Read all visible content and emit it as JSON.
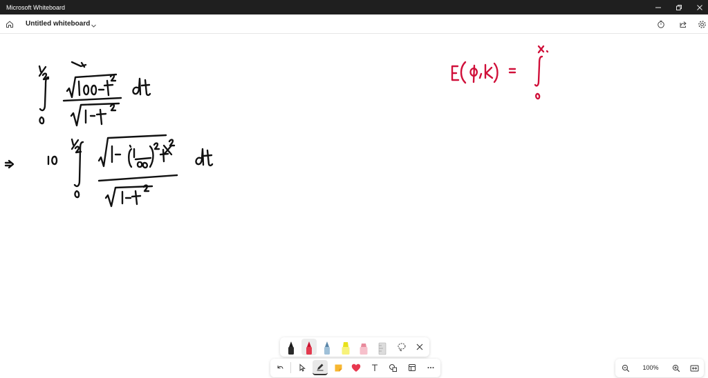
{
  "window": {
    "title": "Microsoft Whiteboard",
    "controls": [
      "minimize",
      "restore",
      "close"
    ]
  },
  "header": {
    "board_name": "Untitled whiteboard",
    "icons": [
      "home-icon",
      "chevron-down-icon",
      "timer-icon",
      "share-icon",
      "settings-icon"
    ]
  },
  "canvas": {
    "ink_black": "#111111",
    "ink_red": "#d0103a"
  },
  "pen_tray": {
    "pens": [
      {
        "name": "black-pen",
        "color": "#1a1a1a"
      },
      {
        "name": "red-pen",
        "color": "#c8102e",
        "active": true
      },
      {
        "name": "blue-pen",
        "color": "#7fa7c4"
      },
      {
        "name": "yellow-highlighter",
        "color": "#f4ee3a"
      },
      {
        "name": "pink-highlighter",
        "color": "#f2a7b4"
      },
      {
        "name": "ruler",
        "color": "#cccccc"
      }
    ]
  },
  "toolbar": {
    "tools": [
      "undo-icon",
      "select-icon",
      "pen-icon",
      "sticky-note-icon",
      "reactions-icon",
      "text-icon",
      "shapes-icon",
      "templates-icon",
      "more-icon"
    ],
    "active_tool": "pen-icon"
  },
  "zoom": {
    "level": "100%"
  }
}
